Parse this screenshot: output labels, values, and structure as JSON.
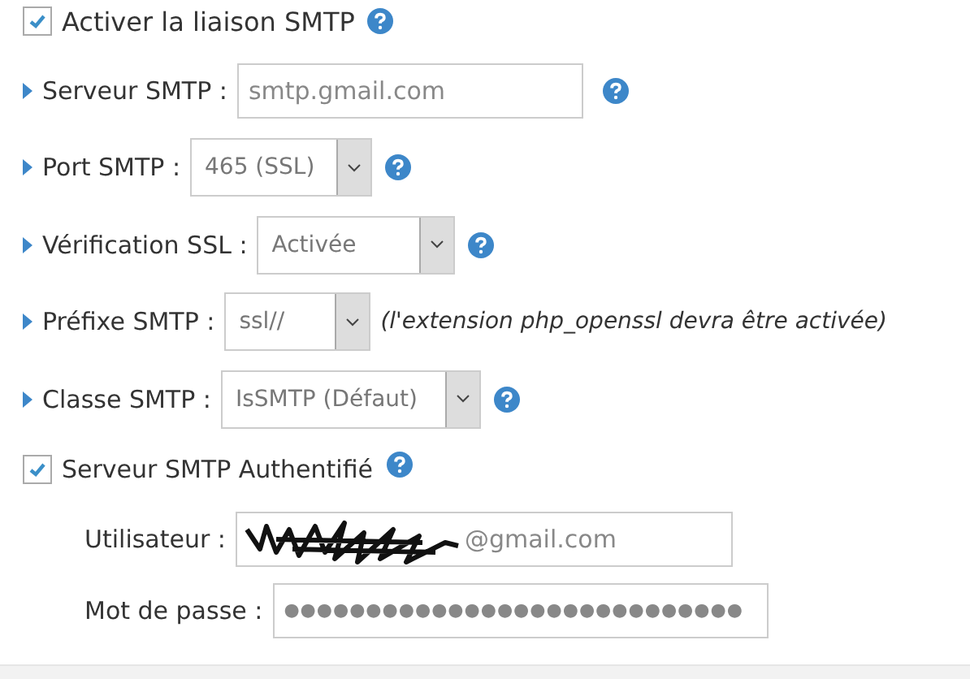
{
  "enable": {
    "label": "Activer la liaison SMTP",
    "checked": true,
    "help": true
  },
  "fields": [
    {
      "kind": "text",
      "label": "Serveur SMTP :",
      "value": "smtp.gmail.com",
      "help": true
    },
    {
      "kind": "select",
      "label": "Port SMTP :",
      "value": "465 (SSL)",
      "help": true
    },
    {
      "kind": "select",
      "label": "Vérification SSL :",
      "value": "Activée",
      "help": true
    },
    {
      "kind": "select",
      "label": "Préfixe SMTP :",
      "value": "ssl//",
      "help": false,
      "note": "(l'extension php_openssl devra être activée)"
    },
    {
      "kind": "select",
      "label": "Classe SMTP :",
      "value": "IsSMTP (Défaut)",
      "help": true
    }
  ],
  "auth": {
    "label": "Serveur SMTP Authentifié",
    "checked": true,
    "help": true
  },
  "credentials": [
    {
      "label": "Utilisateur :",
      "value": "@gmail.com",
      "redacted": true
    },
    {
      "label": "Mot de passe :",
      "value": "●●●●●●●●●●●●●●●●●●●●●●●●●●●●",
      "redacted": false
    }
  ]
}
